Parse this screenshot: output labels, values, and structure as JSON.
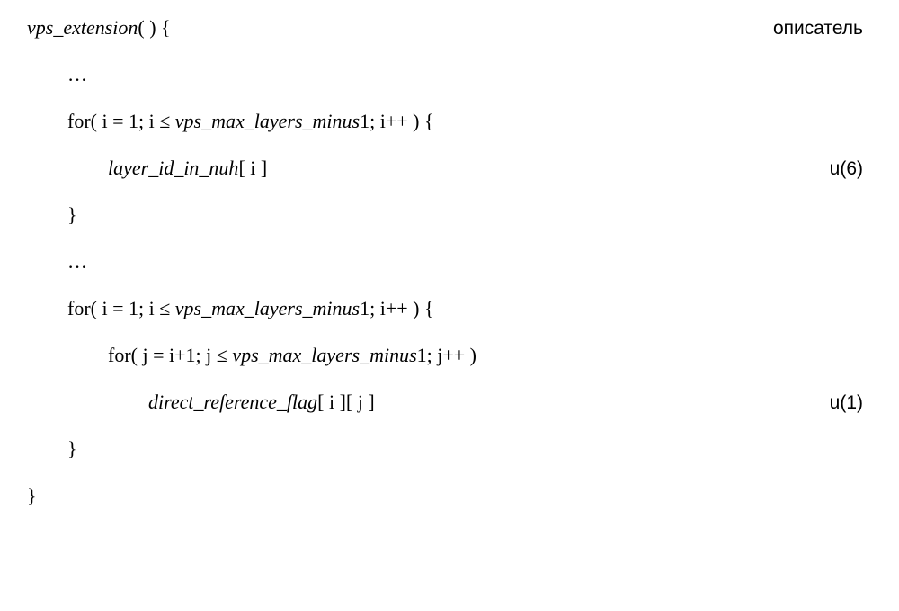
{
  "header_right": "описатель",
  "lines": {
    "l1": "vps_extension",
    "l1_tail": "( ) {",
    "l2": "…",
    "l3a": "for( i = 1; i ≤ ",
    "l3b": "vps_max_layers_minus",
    "l3c": "1; i++ ) {",
    "l4": "layer_id_in_nuh",
    "l4b": "[ i ]",
    "d4": "u(6)",
    "l5": "}",
    "l6": "…",
    "l7a": "for( i = 1; i ≤ ",
    "l7b": "vps_max_layers_minus",
    "l7c": "1; i++ ) {",
    "l8a": "for( j = i+1; j ≤ ",
    "l8b": "vps_max_layers_minus",
    "l8c": "1; j++ )",
    "l9": "direct_reference_flag",
    "l9b": "[ i ][ j ]",
    "d9": "u(1)",
    "l10": "}",
    "l11": "}"
  }
}
